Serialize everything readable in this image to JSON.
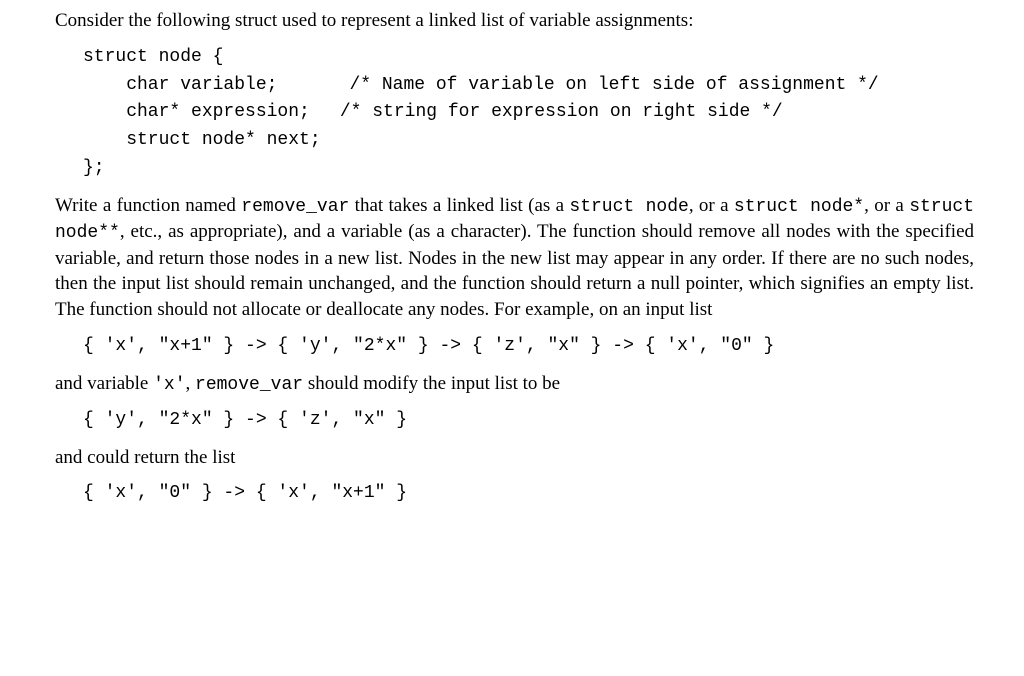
{
  "intro": {
    "text": "Consider the following struct used to represent a linked list of variable assignments:"
  },
  "struct_code": {
    "l1": "struct node {",
    "l2a": "    char variable;",
    "l2b": "/* Name of variable on left side of assignment */",
    "l3a": "    char* expression;",
    "l3b": "/* string for expression on right side */",
    "l4": "    struct node* next;",
    "l5": "};"
  },
  "task": {
    "p1a": "Write a function named ",
    "code1": "remove_var",
    "p1b": " that takes a linked list (as a ",
    "code2": "struct node",
    "p1c": ", or a ",
    "code3": "struct node*",
    "p1d": ", or a ",
    "code4": "struct node**",
    "p1e": ", etc., as appropriate), and a variable (as a character). The function should remove all nodes with the specified variable, and return those nodes in a new list. Nodes in the new list may appear in any order. If there are no such nodes, then the input list should remain unchanged, and the function should return a null pointer, which signifies an empty list. The function should not allocate or deallocate any nodes. For example, on an input list"
  },
  "example": {
    "list1": "{ 'x', \"x+1\" } -> { 'y', \"2*x\" } -> { 'z', \"x\" } -> { 'x', \"0\" }",
    "mid1a": "and variable ",
    "mid1b": "'x'",
    "mid1c": ", ",
    "mid1d": "remove_var",
    "mid1e": " should modify the input list to be",
    "list2": "{ 'y', \"2*x\" } -> { 'z', \"x\" }",
    "mid2": "and could return the list",
    "list3": "{ 'x', \"0\" } -> { 'x', \"x+1\" }"
  }
}
